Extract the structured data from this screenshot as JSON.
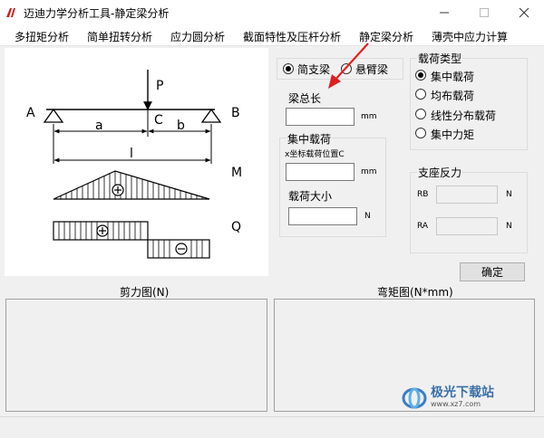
{
  "window": {
    "title": "迈迪力学分析工具-静定梁分析",
    "minimize_icon": "minimize-icon",
    "maximize_icon": "maximize-icon",
    "close_icon": "close-icon"
  },
  "menu": {
    "items": [
      "多扭矩分析",
      "简单扭转分析",
      "应力圆分析",
      "截面特性及压杆分析",
      "静定梁分析",
      "薄壳中应力计算"
    ]
  },
  "diagram": {
    "load_label": "P",
    "left_support": "A",
    "right_support": "B",
    "point_c": "C",
    "dim_a": "a",
    "dim_b": "b",
    "dim_l": "l",
    "moment_label": "M",
    "shear_label": "Q"
  },
  "beam_type": {
    "options": [
      "简支梁",
      "悬臂梁"
    ],
    "selected": "简支梁"
  },
  "beam_length": {
    "label": "梁总长",
    "value": "",
    "unit": "mm"
  },
  "concentrated_load": {
    "group_label": "集中载荷",
    "position_label": "x坐标载荷位置C",
    "position_value": "",
    "position_unit": "mm",
    "magnitude_label": "载荷大小",
    "magnitude_value": "",
    "magnitude_unit": "N"
  },
  "load_type": {
    "group_label": "载荷类型",
    "options": [
      "集中载荷",
      "均布载荷",
      "线性分布载荷",
      "集中力矩"
    ],
    "selected": "集中载荷"
  },
  "reactions": {
    "group_label": "支座反力",
    "rb_label": "RB",
    "rb_value": "",
    "rb_unit": "N",
    "ra_label": "RA",
    "ra_value": "",
    "ra_unit": "N"
  },
  "confirm_label": "确定",
  "shear_chart_label": "剪力图(N)",
  "moment_chart_label": "弯矩图(N*mm)",
  "watermark": {
    "brand": "极光下载站",
    "url": "www.xz7.com"
  },
  "colors": {
    "accent_arrow": "#e02020",
    "window_bg": "#f0f0f0"
  }
}
